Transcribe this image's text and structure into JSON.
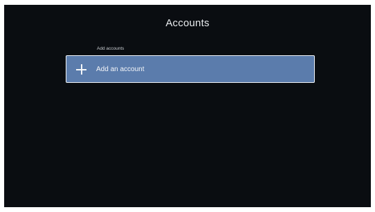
{
  "header": {
    "title": "Accounts"
  },
  "accounts_section": {
    "label": "Add accounts",
    "add_account_label": "Add an account",
    "add_icon": "plus-icon"
  },
  "colors": {
    "background": "#0a0d11",
    "selected_row": "#5b7cac",
    "focus_border": "#f2f4f7"
  }
}
